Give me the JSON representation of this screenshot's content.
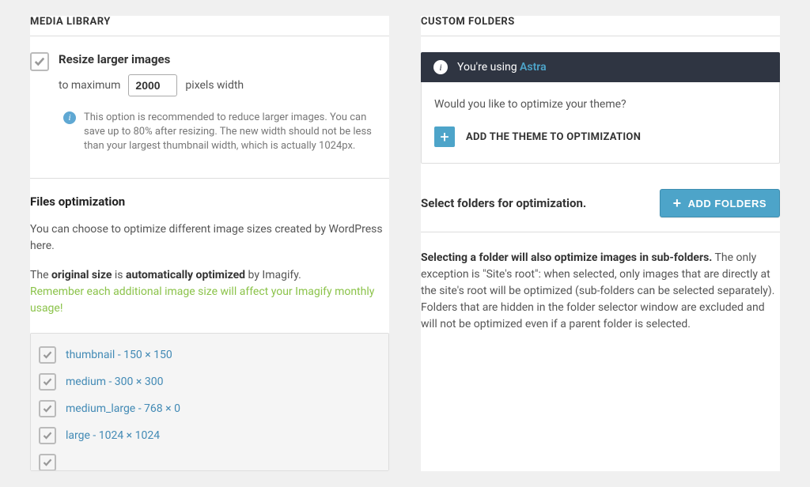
{
  "left": {
    "section_title": "MEDIA LIBRARY",
    "resize": {
      "label": "Resize larger images",
      "prefix": "to maximum",
      "value": "2000",
      "suffix": "pixels width",
      "info": "This option is recommended to reduce larger images. You can save up to 80% after resizing. The new width should not be less than your largest thumbnail width, which is actually 1024px."
    },
    "files": {
      "title": "Files optimization",
      "desc": "You can choose to optimize different image sizes created by WordPress here.",
      "orig_pre": "The ",
      "orig_bold1": "original size",
      "orig_mid": " is ",
      "orig_bold2": "automatically optimized",
      "orig_post": " by Imagify.",
      "note": "Remember each additional image size will affect your Imagify monthly usage!",
      "sizes": [
        {
          "label": "thumbnail - 150 × 150"
        },
        {
          "label": "medium - 300 × 300"
        },
        {
          "label": "medium_large - 768 × 0"
        },
        {
          "label": "large - 1024 × 1024"
        }
      ]
    }
  },
  "right": {
    "section_title": "CUSTOM FOLDERS",
    "theme": {
      "using_pre": "You're using ",
      "theme_name": "Astra",
      "question": "Would you like to optimize your theme?",
      "add_label": "ADD THE THEME TO OPTIMIZATION"
    },
    "folders": {
      "select_title": "Select folders for optimization.",
      "add_btn": "ADD FOLDERS",
      "desc_bold": "Selecting a folder will also optimize images in sub-folders.",
      "desc_rest": " The only exception is \"Site's root\": when selected, only images that are directly at the site's root will be optimized (sub-folders can be selected separately).",
      "desc2": "Folders that are hidden in the folder selector window are excluded and will not be optimized even if a parent folder is selected."
    }
  }
}
